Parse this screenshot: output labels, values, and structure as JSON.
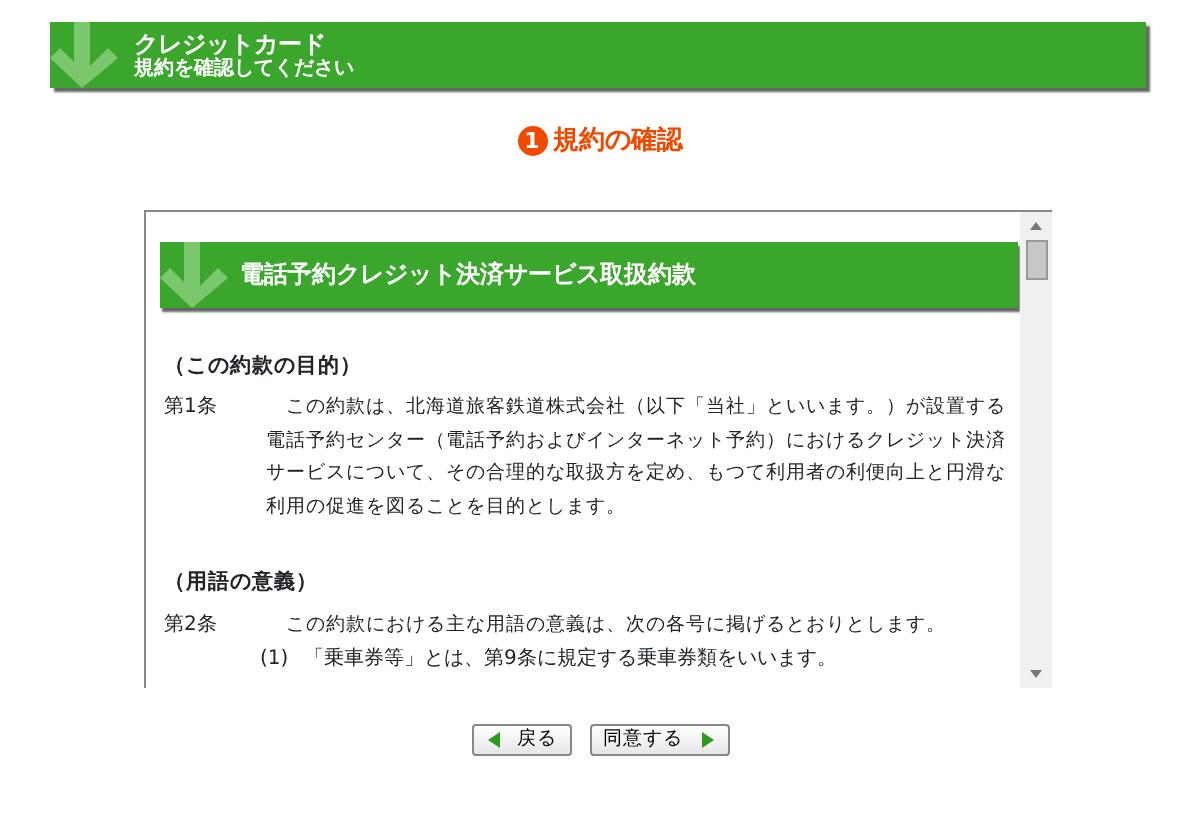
{
  "header": {
    "title": "クレジットカード",
    "subtitle": "規約を確認してください"
  },
  "step": {
    "number": "1",
    "label": "規約の確認"
  },
  "terms": {
    "title": "電話予約クレジット決済サービス取扱約款",
    "sections": [
      {
        "heading": "（この約款の目的）",
        "article": "第1条",
        "text": "　この約款は、北海道旅客鉄道株式会社（以下「当社」といいます。）が設置する電話予約センター（電話予約およびインターネット予約）におけるクレジット決済サービスについて、その合理的な取扱方を定め、もつて利用者の利便向上と円滑な利用の促進を図ることを目的とします。"
      },
      {
        "heading": "（用語の意義）",
        "article": "第2条",
        "text": "　この約款における主な用語の意義は、次の各号に掲げるとおりとします。",
        "items": [
          {
            "number": "(1)",
            "text": "「乗車券等」とは、第9条に規定する乗車券類をいいます。"
          }
        ]
      }
    ]
  },
  "buttons": [
    {
      "label": "戻る",
      "kind": "back"
    },
    {
      "label": "同意する",
      "kind": "next"
    }
  ]
}
